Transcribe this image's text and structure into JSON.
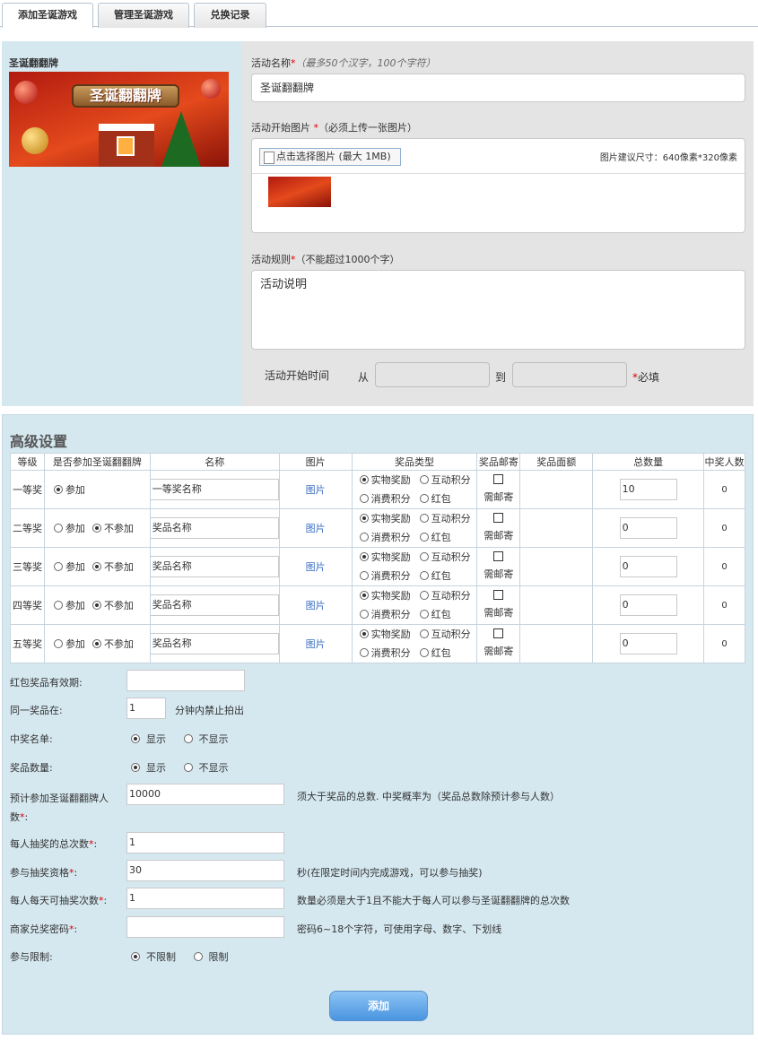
{
  "tabs": [
    {
      "label": "添加圣诞游戏"
    },
    {
      "label": "管理圣诞游戏"
    },
    {
      "label": "兑换记录"
    }
  ],
  "preview": {
    "title": "圣诞翻翻牌",
    "banner_text": "圣诞翻翻牌"
  },
  "form": {
    "name_label": "活动名称",
    "name_hint": "（最多50个汉字，100个字符）",
    "name_value": "圣诞翻翻牌",
    "image_label": "活动开始图片 ",
    "image_hint": "（必须上传一张图片）",
    "file_button": "点击选择图片 (最大 1MB)",
    "image_size_hint": "图片建议尺寸：640像素*320像素",
    "rules_label": "活动规则",
    "rules_hint": "（不能超过1000个字）",
    "rules_value": "活动说明",
    "time_label": "活动开始时间",
    "from": "从",
    "to": "到",
    "required_text": "必填"
  },
  "advanced": {
    "title": "高级设置",
    "headers": [
      "等级",
      "是否参加圣诞翻翻牌",
      "名称",
      "图片",
      "奖品类型",
      "奖品邮寄",
      "奖品面额",
      "总数量",
      "中奖人数"
    ],
    "join_label": "参加",
    "not_join_label": "不参加",
    "image_link": "图片",
    "type_options": [
      "实物奖励",
      "互动积分",
      "消费积分",
      "红包"
    ],
    "mail_label": "需邮寄",
    "rows": [
      {
        "level": "一等奖",
        "joined": true,
        "only_join": true,
        "name": "一等奖名称",
        "count": "10",
        "winners": "0"
      },
      {
        "level": "二等奖",
        "joined": false,
        "only_join": false,
        "name": "奖品名称",
        "count": "0",
        "winners": "0"
      },
      {
        "level": "三等奖",
        "joined": false,
        "only_join": false,
        "name": "奖品名称",
        "count": "0",
        "winners": "0"
      },
      {
        "level": "四等奖",
        "joined": false,
        "only_join": false,
        "name": "奖品名称",
        "count": "0",
        "winners": "0"
      },
      {
        "level": "五等奖",
        "joined": false,
        "only_join": false,
        "name": "奖品名称",
        "count": "0",
        "winners": "0"
      }
    ],
    "settings": {
      "redpacket_label": "红包奖品有效期:",
      "same_prize_label": "同一奖品在:",
      "same_prize_value": "1",
      "same_prize_suffix": "分钟内禁止拍出",
      "winner_list_label": "中奖名单:",
      "prize_count_label": "奖品数量:",
      "show": "显示",
      "hide": "不显示",
      "expected_label_1": "预计参加圣诞翻翻牌人",
      "expected_label_2": "数",
      "expected_value": "10000",
      "expected_hint": "须大于奖品的总数. 中奖概率为（奖品总数除预计参与人数）",
      "draws_label": "每人抽奖的总次数",
      "draws_value": "1",
      "qualify_label": "参与抽奖资格",
      "qualify_value": "30",
      "qualify_hint": "秒(在限定时间内完成游戏，可以参与抽奖)",
      "daily_label": "每人每天可抽奖次数",
      "daily_value": "1",
      "daily_hint": "数量必须是大于1且不能大于每人可以参与圣诞翻翻牌的总次数",
      "password_label": "商家兑奖密码",
      "password_hint": "密码6~18个字符，可使用字母、数字、下划线",
      "limit_label": "参与限制:",
      "no_limit": "不限制",
      "limit": "限制"
    },
    "submit_label": "添加"
  }
}
